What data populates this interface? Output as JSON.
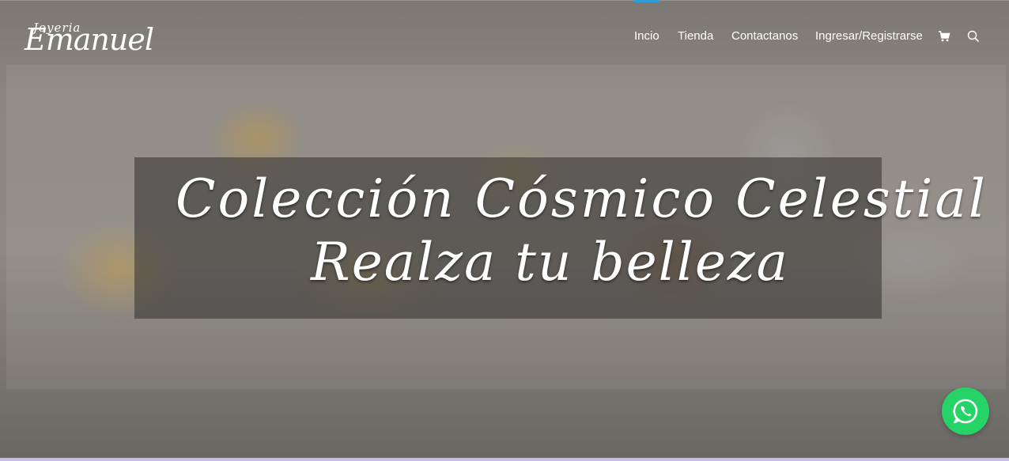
{
  "header": {
    "logo_top": "Joyeria",
    "logo_main": "Emanuel",
    "nav": [
      {
        "label": "Incio",
        "active": true
      },
      {
        "label": "Tienda",
        "active": false
      },
      {
        "label": "Contactanos",
        "active": false
      },
      {
        "label": "Ingresar/Registrarse",
        "active": false
      }
    ],
    "icons": [
      "cart-icon",
      "search-icon"
    ],
    "active_color": "#2c9bd6"
  },
  "hero": {
    "line1": "Colección Cósmico Celestial",
    "line2": "Realza tu belleza"
  },
  "whatsapp": {
    "icon": "whatsapp-icon",
    "color": "#25d366"
  }
}
